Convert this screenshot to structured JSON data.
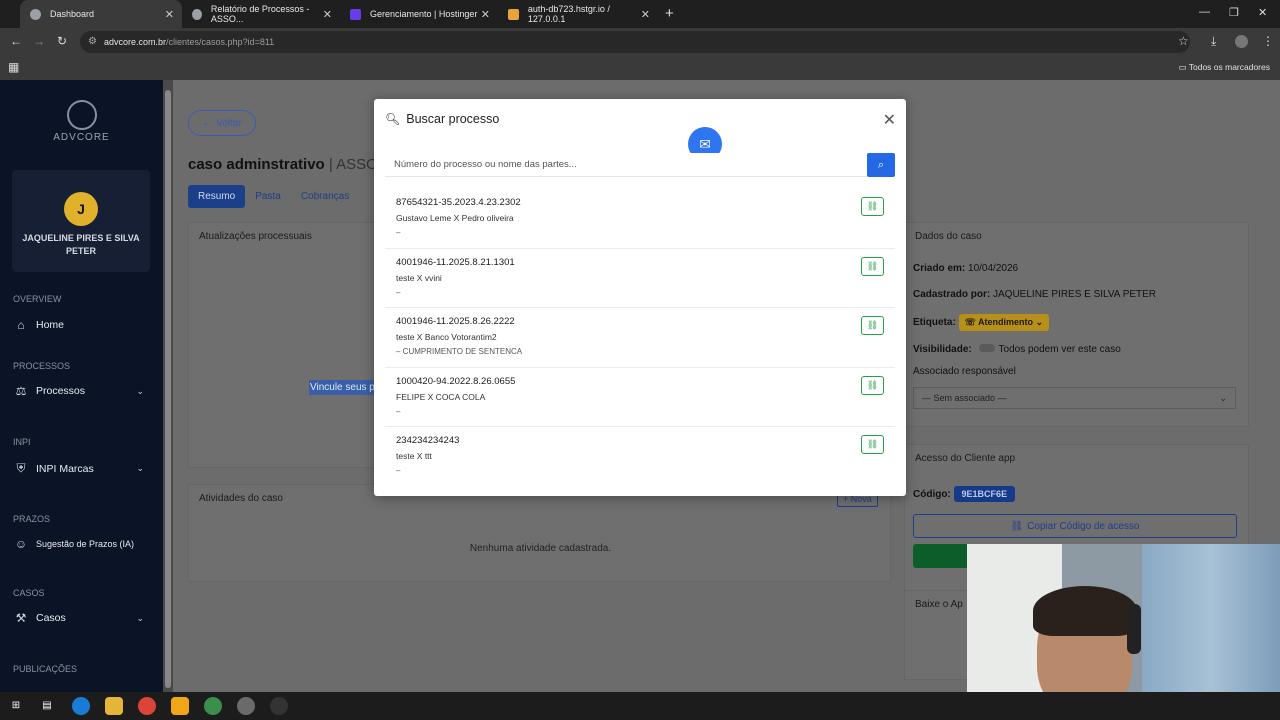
{
  "browser": {
    "tabs": [
      {
        "label": "Dashboard",
        "color": "#9aa0a6"
      },
      {
        "label": "Relatório de Processos - ASSO...",
        "color": "#9aa0a6"
      },
      {
        "label": "Gerenciamento | Hostinger",
        "color": "#673de6"
      },
      {
        "label": "auth-db723.hstgr.io / 127.0.0.1",
        "color": "#e8a33d"
      }
    ],
    "url_host": "advcore.com.br",
    "url_path": "/clientes/casos.php?id=811",
    "bookmarks_label": "Todos os marcadores"
  },
  "sidebar": {
    "logo_text": "ADVCORE",
    "user_initial": "J",
    "user_name": "JAQUELINE PIRES E SILVA PETER",
    "sections": {
      "overview": "OVERVIEW",
      "processos": "PROCESSOS",
      "inpi": "INPI",
      "prazos": "PRAZOS",
      "casos": "CASOS",
      "publicacoes": "PUBLICAÇÕES"
    },
    "items": {
      "home": "Home",
      "processos": "Processos",
      "inpi_marcas": "INPI Marcas",
      "sugestao_prazos": "Sugestão de Prazos (IA)",
      "casos": "Casos"
    }
  },
  "main": {
    "back_label": "Voltar",
    "case_title": "caso adminstrativo",
    "case_title_sub": "| ASSO",
    "tabs": [
      "Resumo",
      "Pasta",
      "Cobranças"
    ],
    "updates_title": "Atualizações processuais",
    "selected_text": "Vincule seus p",
    "activities_title": "Atividades do caso",
    "new_label": "+ Nova",
    "no_activities": "Nenhuma atividade cadastrada.",
    "case_data_title": "Dados do caso",
    "created_label": "Criado em:",
    "created_value": "10/04/2026",
    "registered_label": "Cadastrado por:",
    "registered_value": "JAQUELINE PIRES E SILVA PETER",
    "tag_label": "Etiqueta:",
    "tag_value": "Atendimento",
    "visibility_label": "Visibilidade:",
    "visibility_value": "Todos podem ver este caso",
    "assoc_label": "Associado responsável",
    "assoc_value": "— Sem associado —",
    "client_access_title": "Acesso do Cliente app",
    "code_label": "Código:",
    "code_value": "9E1BCF6E",
    "copy_label": "Copiar Código de acesso",
    "download_label": "Baixe o Ap"
  },
  "modal": {
    "title": "Buscar processo",
    "search_placeholder": "Número do processo ou nome das partes...",
    "results": [
      {
        "number": "87654321-35.2023.4.23.2302",
        "parties": "Gustavo Leme X Pedro oliveira",
        "extra": "–"
      },
      {
        "number": "4001946-11.2025.8.21.1301",
        "parties": "teste X vvini",
        "extra": "–"
      },
      {
        "number": "4001946-11.2025.8.26.2222",
        "parties": "teste X Banco Votorantim2",
        "extra": "– CUMPRIMENTO DE SENTENCA"
      },
      {
        "number": "1000420-94.2022.8.26.0655",
        "parties": "FELIPE X COCA COLA",
        "extra": "–"
      },
      {
        "number": "234234234243",
        "parties": "teste X ttt",
        "extra": "–"
      }
    ]
  },
  "colors": {
    "sidebar_bg": "#0b1426",
    "primary": "#2468e6",
    "link_green": "#27a04a",
    "badge_yellow": "#e0b12a"
  }
}
